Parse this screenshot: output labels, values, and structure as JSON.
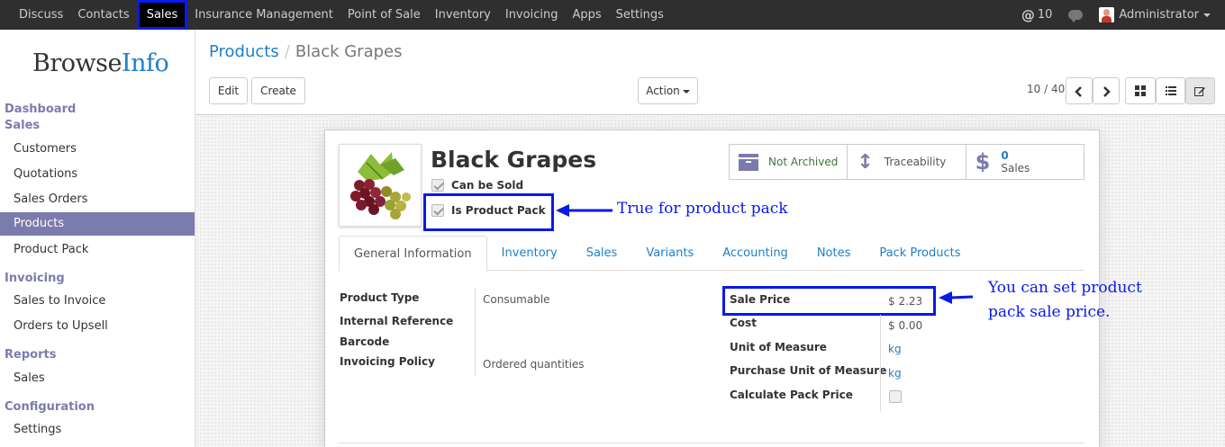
{
  "topbar": {
    "menu": [
      "Discuss",
      "Contacts",
      "Sales",
      "Insurance Management",
      "Point of Sale",
      "Inventory",
      "Invoicing",
      "Apps",
      "Settings"
    ],
    "active_menu": "Sales",
    "mentions_count": "10",
    "user_name": "Administrator"
  },
  "sidebar": {
    "logo_part1": "Browse",
    "logo_part2": "Info",
    "dashboard": "Dashboard",
    "sales_section": "Sales",
    "sales_items": [
      "Customers",
      "Quotations",
      "Sales Orders",
      "Products",
      "Product Pack"
    ],
    "invoicing_section": "Invoicing",
    "invoicing_items": [
      "Sales to Invoice",
      "Orders to Upsell"
    ],
    "reports_section": "Reports",
    "reports_items": [
      "Sales"
    ],
    "configuration_section": "Configuration",
    "configuration_items": [
      "Settings"
    ]
  },
  "breadcrumb": {
    "parent": "Products",
    "current": "Black Grapes"
  },
  "toolbar": {
    "edit_label": "Edit",
    "create_label": "Create",
    "action_label": "Action",
    "pager": "10 / 40"
  },
  "form": {
    "title": "Black Grapes",
    "can_be_sold_label": "Can be Sold",
    "can_be_sold": true,
    "is_product_pack_label": "Is Product Pack",
    "is_product_pack": true,
    "stat_buttons": {
      "archive_label": "Not Archived",
      "traceability_label": "Traceability",
      "sales_count": "0",
      "sales_label": "Sales"
    },
    "tabs": [
      "General Information",
      "Inventory",
      "Sales",
      "Variants",
      "Accounting",
      "Notes",
      "Pack Products"
    ],
    "active_tab": "General Information",
    "left_fields": {
      "product_type_label": "Product Type",
      "product_type_value": "Consumable",
      "internal_reference_label": "Internal Reference",
      "barcode_label": "Barcode",
      "invoicing_policy_label": "Invoicing Policy",
      "invoicing_policy_value": "Ordered quantities"
    },
    "right_fields": {
      "sale_price_label": "Sale Price",
      "sale_price_value": "$ 2.23",
      "cost_label": "Cost",
      "cost_value": "$ 0.00",
      "uom_label": "Unit of Measure",
      "uom_value": "kg",
      "purchase_uom_label": "Purchase Unit of Measure",
      "purchase_uom_value": "kg",
      "calc_pack_price_label": "Calculate Pack Price",
      "calc_pack_price": false
    }
  },
  "annotations": {
    "pack_note": "True for product pack",
    "price_note_line1": "You can set product",
    "price_note_line2": "pack sale price."
  },
  "colors": {
    "accent": "#7c7bad",
    "link": "#1e7fc7",
    "annotation": "#0a1ae6",
    "topbar": "#2f2f2f"
  }
}
